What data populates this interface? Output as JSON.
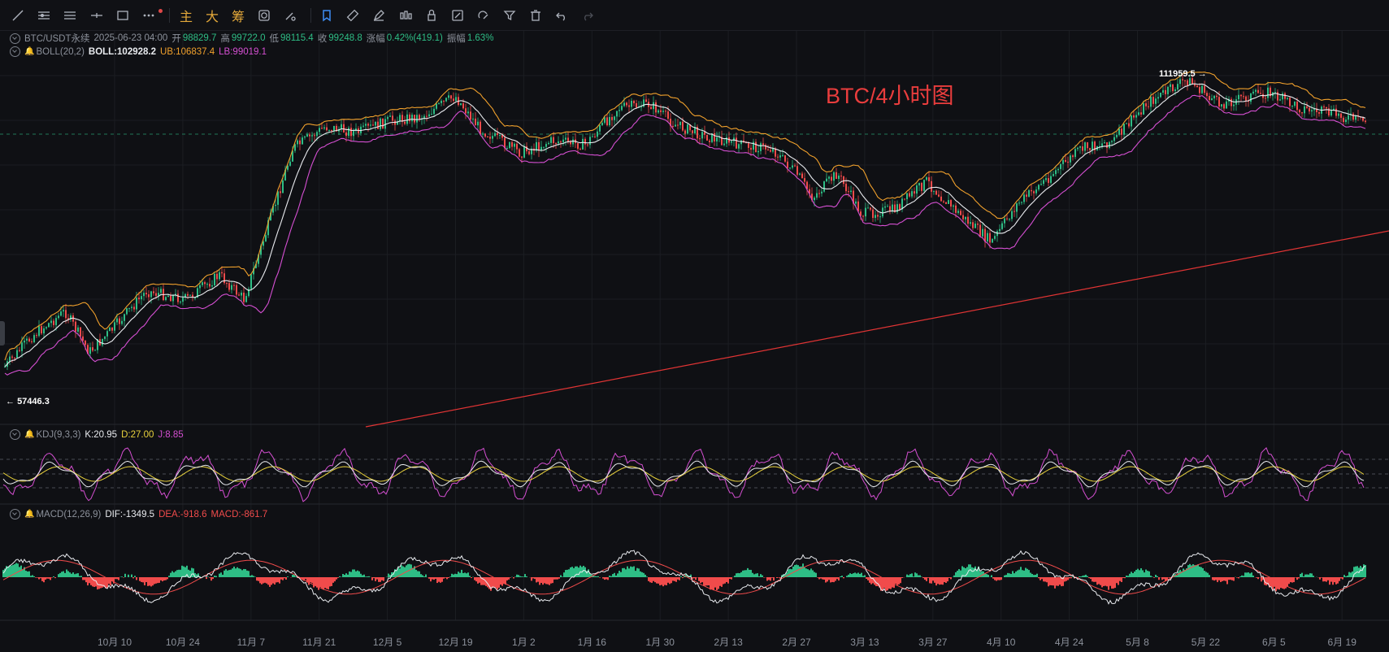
{
  "toolbar": {
    "tools": [
      {
        "name": "trendline-icon"
      },
      {
        "name": "horizontal-lines-icon"
      },
      {
        "name": "parallel-lines-icon"
      },
      {
        "name": "crosshair-line-icon"
      },
      {
        "name": "rectangle-icon"
      },
      {
        "name": "more-icon"
      }
    ],
    "text_buttons": [
      "主",
      "大",
      "筹"
    ],
    "right_tools": [
      {
        "name": "sync-icon"
      },
      {
        "name": "brush-settings-icon"
      },
      {
        "name": "bookmark-icon",
        "active": true
      },
      {
        "name": "ruler-icon"
      },
      {
        "name": "pen-icon"
      },
      {
        "name": "candlestick-icon"
      },
      {
        "name": "lock-icon"
      },
      {
        "name": "edit-note-icon"
      },
      {
        "name": "magnet-icon"
      },
      {
        "name": "filter-icon"
      },
      {
        "name": "trash-icon"
      },
      {
        "name": "undo-icon"
      },
      {
        "name": "redo-icon",
        "disabled": true
      }
    ]
  },
  "ohlc": {
    "symbol": "BTC/USDT永续",
    "datetime": "2025-06-23 04:00",
    "open_label": "开",
    "open": "98829.7",
    "high_label": "高",
    "high": "99722.0",
    "low_label": "低",
    "low": "98115.4",
    "close_label": "收",
    "close": "99248.8",
    "change_label": "涨幅",
    "change": "0.42%(419.1)",
    "amp_label": "振幅",
    "amp": "1.63%"
  },
  "boll": {
    "label": "BOLL(20,2)",
    "mid": "BOLL:102928.2",
    "ub": "UB:106837.4",
    "lb": "LB:99019.1"
  },
  "kdj": {
    "label": "KDJ(9,3,3)",
    "k": "K:20.95",
    "d": "D:27.00",
    "j": "J:8.85"
  },
  "macd": {
    "label": "MACD(12,26,9)",
    "dif": "DIF:-1349.5",
    "dea": "DEA:-918.6",
    "macd": "MACD:-861.7"
  },
  "annotation": "BTC/4小时图",
  "max_label": "111959.5",
  "min_label": "57446.3",
  "dates": [
    "10月 10",
    "10月 24",
    "11月 7",
    "11月 21",
    "12月 5",
    "12月 19",
    "1月 2",
    "1月 16",
    "1月 30",
    "2月 13",
    "2月 27",
    "3月 13",
    "3月 27",
    "4月 10",
    "4月 24",
    "5月 8",
    "5月 22",
    "6月 5",
    "6月 19"
  ],
  "colors": {
    "up": "#2ebd85",
    "down": "#f04b4b",
    "boll_mid": "#e8eaee",
    "boll_ub": "#f0a02c",
    "boll_lb": "#d54fd2",
    "trendline": "#e03434"
  },
  "chart_data": {
    "type": "line",
    "title": "BTC/4小时图",
    "x": [
      "10月 10",
      "10月 24",
      "11月 7",
      "11月 21",
      "12月 5",
      "12月 19",
      "1月 2",
      "1月 16",
      "1月 30",
      "2月 13",
      "2月 27",
      "3月 13",
      "3月 27",
      "4月 10",
      "4月 24",
      "5月 8",
      "5月 22",
      "6月 5",
      "6月 19"
    ],
    "series": [
      {
        "name": "BOLL",
        "values": [
          62000,
          66000,
          74000,
          92000,
          97500,
          101000,
          95000,
          98000,
          103000,
          97500,
          86000,
          82000,
          85000,
          79000,
          90000,
          97000,
          108000,
          106000,
          104500
        ]
      }
    ],
    "max": 111959.5,
    "min": 57446.3,
    "grid": true
  }
}
